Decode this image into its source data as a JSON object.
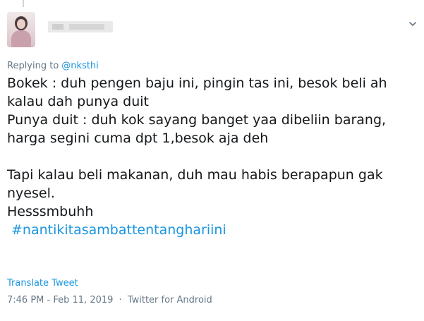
{
  "reply": {
    "prefix": "Replying to",
    "handle": "@nksthi"
  },
  "tweet": {
    "lines": [
      "Bokek : duh pengen baju ini, pingin tas ini, besok beli ah",
      "kalau dah punya duit",
      "Punya duit : duh kok sayang banget yaa dibeliin barang,",
      "harga segini cuma dpt 1,besok aja deh",
      "",
      "Tapi kalau beli makanan, duh mau habis berapapun gak",
      "nyesel.",
      "Hesssmbuhh"
    ],
    "hashtag": "#nantikitasambattentanghariini"
  },
  "actions": {
    "translate": "Translate Tweet"
  },
  "meta": {
    "time": "7:46 PM",
    "date": "Feb 11, 2019",
    "separator": "·",
    "source": "Twitter for Android"
  },
  "icons": {
    "caret": "chevron-down-icon",
    "avatar": "avatar"
  },
  "colors": {
    "link": "#1b95e0",
    "muted": "#657786",
    "text": "#14171a"
  }
}
